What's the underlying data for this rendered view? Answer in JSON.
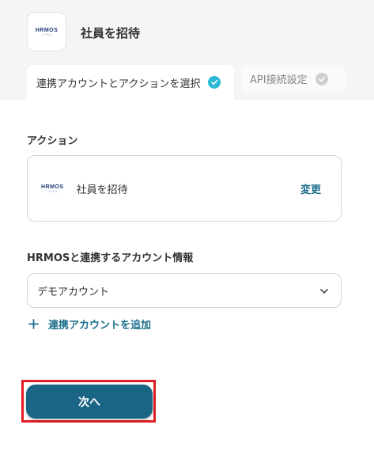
{
  "app": {
    "logo_text": "HRMOS",
    "logo_subtext": "ハーモス",
    "title": "社員を招待"
  },
  "tabs": [
    {
      "label": "連携アカウントとアクションを選択",
      "state": "active"
    },
    {
      "label": "API接続設定",
      "state": "inactive"
    }
  ],
  "action_section": {
    "label": "アクション",
    "action_name": "社員を招待",
    "change_label": "変更"
  },
  "account_section": {
    "label": "HRMOSと連携するアカウント情報",
    "selected_account": "デモアカウント",
    "add_account_label": "連携アカウントを追加"
  },
  "next_button_label": "次へ",
  "colors": {
    "accent": "#1a6585",
    "link": "#1d6f8d",
    "check_active": "#2cb8d4",
    "highlight": "#e01e23"
  }
}
